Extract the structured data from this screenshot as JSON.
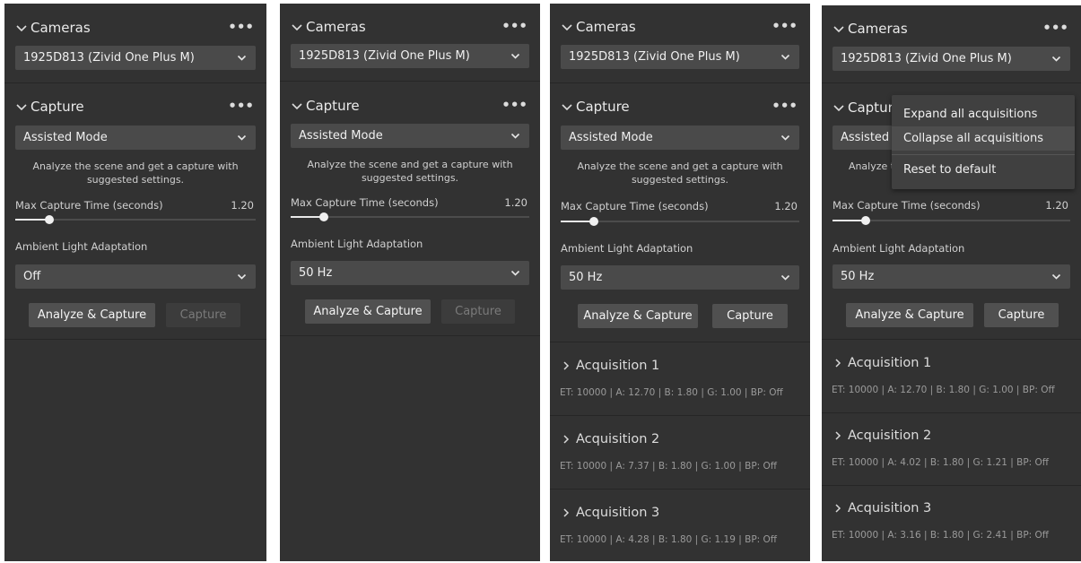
{
  "panels": [
    {
      "cameras": {
        "title": "Cameras",
        "more": "•••",
        "selected": "1925D813 (Zivid One Plus M)"
      },
      "capture": {
        "title": "Capture",
        "more": "•••",
        "mode": "Assisted Mode",
        "description_line1": "Analyze the scene and get a capture with",
        "description_line2": "suggested settings.",
        "max_time_label": "Max Capture Time (seconds)",
        "max_time_value": "1.20",
        "slider_fraction": 0.14,
        "ambient_label": "Ambient Light Adaptation",
        "ambient_value": "Off",
        "analyze_button": "Analyze & Capture",
        "capture_button": "Capture",
        "capture_enabled": false
      },
      "acquisitions": []
    },
    {
      "cameras": {
        "title": "Cameras",
        "more": "•••",
        "selected": "1925D813 (Zivid One Plus M)"
      },
      "capture": {
        "title": "Capture",
        "more": "•••",
        "mode": "Assisted Mode",
        "description_line1": "Analyze the scene and get a capture with",
        "description_line2": "suggested settings.",
        "max_time_label": "Max Capture Time (seconds)",
        "max_time_value": "1.20",
        "slider_fraction": 0.14,
        "ambient_label": "Ambient Light Adaptation",
        "ambient_value": "50 Hz",
        "analyze_button": "Analyze & Capture",
        "capture_button": "Capture",
        "capture_enabled": false
      },
      "acquisitions": []
    },
    {
      "cameras": {
        "title": "Cameras",
        "more": "•••",
        "selected": "1925D813 (Zivid One Plus M)"
      },
      "capture": {
        "title": "Capture",
        "more": "•••",
        "mode": "Assisted Mode",
        "description_line1": "Analyze the scene and get a capture with",
        "description_line2": "suggested settings.",
        "max_time_label": "Max Capture Time (seconds)",
        "max_time_value": "1.20",
        "slider_fraction": 0.14,
        "ambient_label": "Ambient Light Adaptation",
        "ambient_value": "50 Hz",
        "analyze_button": "Analyze & Capture",
        "capture_button": "Capture",
        "capture_enabled": true
      },
      "acquisitions": [
        {
          "title": "Acquisition 1",
          "params": "ET: 10000  |  A: 12.70  |  B: 1.80  |  G: 1.00  |  BP: Off"
        },
        {
          "title": "Acquisition 2",
          "params": "ET: 10000  |  A: 7.37  |  B: 1.80  |  G: 1.00  |  BP: Off"
        },
        {
          "title": "Acquisition 3",
          "params": "ET: 10000  |  A: 4.28  |  B: 1.80  |  G: 1.19  |  BP: Off"
        }
      ]
    },
    {
      "cameras": {
        "title": "Cameras",
        "more": "•••",
        "selected": "1925D813 (Zivid One Plus M)"
      },
      "capture": {
        "title": "Capture",
        "more": "",
        "mode": "Assisted Mode",
        "description_line1": "Analyze the scene and get a capture with",
        "description_line2": "suggested settings.",
        "max_time_label": "Max Capture Time (seconds)",
        "max_time_value": "1.20",
        "slider_fraction": 0.14,
        "ambient_label": "Ambient Light Adaptation",
        "ambient_value": "50 Hz",
        "analyze_button": "Analyze & Capture",
        "capture_button": "Capture",
        "capture_enabled": true
      },
      "acquisitions": [
        {
          "title": "Acquisition 1",
          "params": "ET: 10000  |  A: 12.70  |  B: 1.80  |  G: 1.00  |  BP: Off"
        },
        {
          "title": "Acquisition 2",
          "params": "ET: 10000  |  A: 4.02  |  B: 1.80  |  G: 1.21  |  BP: Off"
        },
        {
          "title": "Acquisition 3",
          "params": "ET: 10000  |  A: 3.16  |  B: 1.80  |  G: 2.41  |  BP: Off"
        }
      ],
      "context_menu": {
        "items": [
          "Expand all acquisitions",
          "Collapse all acquisitions",
          "Reset to default"
        ],
        "highlighted": 1
      }
    }
  ],
  "icons": {
    "section_chevron": "chevron-down-icon",
    "dropdown_chevron": "chevron-down-icon",
    "acquisition_chevron": "chevron-right-icon",
    "more": "more-horizontal-icon"
  },
  "colors": {
    "panel_bg": "#323232",
    "control_bg": "#4a4a4a",
    "button_bg": "#505050",
    "disabled_text": "#7a7a7a",
    "menu_bg": "#404040",
    "menu_highlight": "#4d4d4d"
  }
}
